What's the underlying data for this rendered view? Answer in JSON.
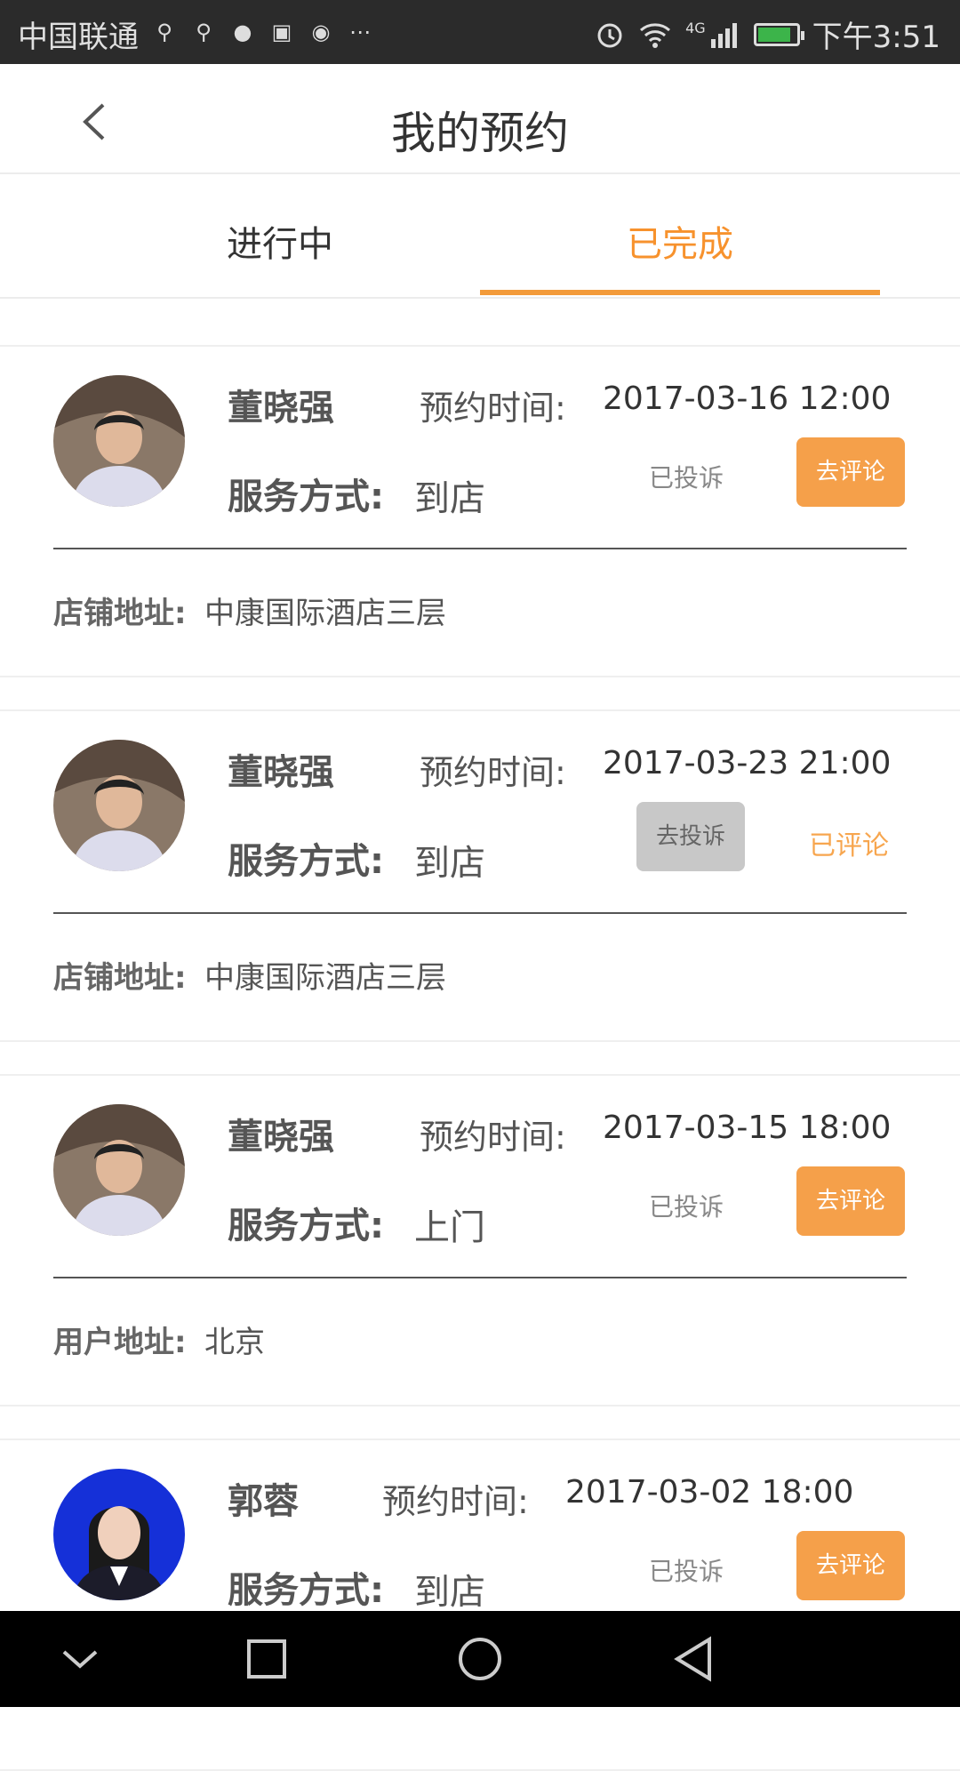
{
  "status_bar": {
    "carrier": "中国联通",
    "time": "下午3:51",
    "network": "4G",
    "battery_level": 0.8,
    "icons": [
      "usb-icon",
      "usb-icon",
      "wechat-icon",
      "huawei-icon",
      "map-icon",
      "more-icon"
    ]
  },
  "header": {
    "title": "我的预约",
    "back_icon": "chevron-left-icon"
  },
  "tabs": [
    {
      "label": "进行中",
      "active": false
    },
    {
      "label": "已完成",
      "active": true
    }
  ],
  "labels": {
    "time_label": "预约时间:",
    "service_label": "服务方式:",
    "complaint_done": "已投诉",
    "review_btn": "去评论",
    "complaint_btn": "去投诉",
    "reviewed": "已评论"
  },
  "appointments": [
    {
      "name": "董晓强",
      "time": "2017-03-16 12:00",
      "service": "到店",
      "address_label": "店铺地址:",
      "address": "中康国际酒店三层"
    },
    {
      "name": "董晓强",
      "time": "2017-03-23 21:00",
      "service": "到店",
      "address_label": "店铺地址:",
      "address": "中康国际酒店三层"
    },
    {
      "name": "董晓强",
      "time": "2017-03-15 18:00",
      "service": "上门",
      "address_label": "用户地址:",
      "address": "北京"
    },
    {
      "name": "郭蓉",
      "time": "2017-03-02 18:00",
      "service": "到店"
    }
  ],
  "colors": {
    "accent": "#f39b3a",
    "button_orange": "#f5a04a",
    "button_gray": "#c8c8c8",
    "status_bar": "#2b2b2b"
  }
}
